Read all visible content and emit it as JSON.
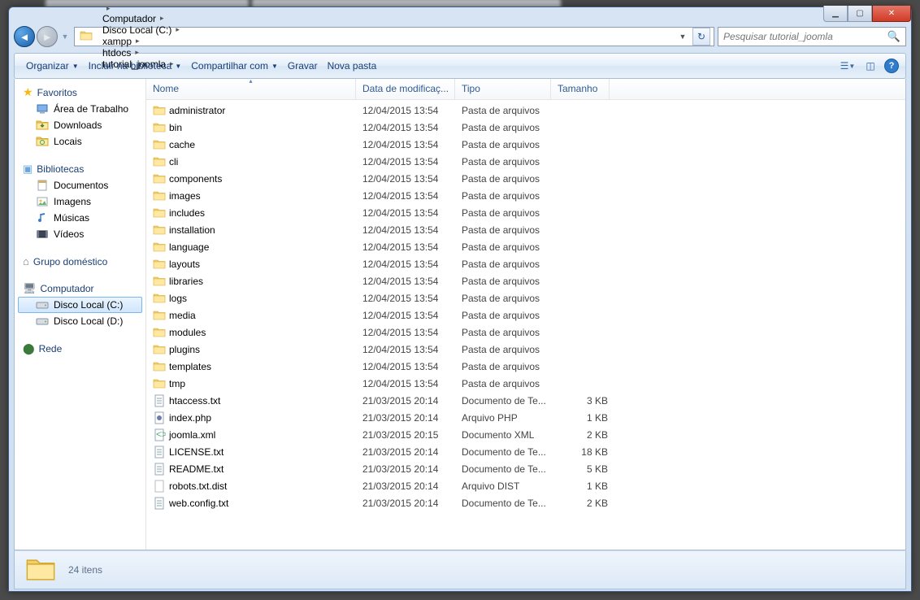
{
  "window_controls": {
    "min": "▁",
    "max": "▢",
    "close": "✕"
  },
  "breadcrumbs": [
    "Computador",
    "Disco Local (C:)",
    "xampp",
    "htdocs",
    "tutorial_joomla"
  ],
  "search": {
    "placeholder": "Pesquisar tutorial_joomla"
  },
  "toolbar": {
    "organize": "Organizar",
    "include": "Incluir na biblioteca",
    "share": "Compartilhar com",
    "burn": "Gravar",
    "newfolder": "Nova pasta"
  },
  "sidebar": {
    "favorites": {
      "label": "Favoritos",
      "items": [
        "Área de Trabalho",
        "Downloads",
        "Locais"
      ]
    },
    "libraries": {
      "label": "Bibliotecas",
      "items": [
        "Documentos",
        "Imagens",
        "Músicas",
        "Vídeos"
      ]
    },
    "homegroup": {
      "label": "Grupo doméstico"
    },
    "computer": {
      "label": "Computador",
      "items": [
        "Disco Local (C:)",
        "Disco Local (D:)"
      ],
      "selected": 0
    },
    "network": {
      "label": "Rede"
    }
  },
  "columns": {
    "name": "Nome",
    "date": "Data de modificaç...",
    "type": "Tipo",
    "size": "Tamanho"
  },
  "rows": [
    {
      "icon": "folder",
      "name": "administrator",
      "date": "12/04/2015 13:54",
      "type": "Pasta de arquivos",
      "size": ""
    },
    {
      "icon": "folder",
      "name": "bin",
      "date": "12/04/2015 13:54",
      "type": "Pasta de arquivos",
      "size": ""
    },
    {
      "icon": "folder",
      "name": "cache",
      "date": "12/04/2015 13:54",
      "type": "Pasta de arquivos",
      "size": ""
    },
    {
      "icon": "folder",
      "name": "cli",
      "date": "12/04/2015 13:54",
      "type": "Pasta de arquivos",
      "size": ""
    },
    {
      "icon": "folder",
      "name": "components",
      "date": "12/04/2015 13:54",
      "type": "Pasta de arquivos",
      "size": ""
    },
    {
      "icon": "folder",
      "name": "images",
      "date": "12/04/2015 13:54",
      "type": "Pasta de arquivos",
      "size": ""
    },
    {
      "icon": "folder",
      "name": "includes",
      "date": "12/04/2015 13:54",
      "type": "Pasta de arquivos",
      "size": ""
    },
    {
      "icon": "folder",
      "name": "installation",
      "date": "12/04/2015 13:54",
      "type": "Pasta de arquivos",
      "size": ""
    },
    {
      "icon": "folder",
      "name": "language",
      "date": "12/04/2015 13:54",
      "type": "Pasta de arquivos",
      "size": ""
    },
    {
      "icon": "folder",
      "name": "layouts",
      "date": "12/04/2015 13:54",
      "type": "Pasta de arquivos",
      "size": ""
    },
    {
      "icon": "folder",
      "name": "libraries",
      "date": "12/04/2015 13:54",
      "type": "Pasta de arquivos",
      "size": ""
    },
    {
      "icon": "folder",
      "name": "logs",
      "date": "12/04/2015 13:54",
      "type": "Pasta de arquivos",
      "size": ""
    },
    {
      "icon": "folder",
      "name": "media",
      "date": "12/04/2015 13:54",
      "type": "Pasta de arquivos",
      "size": ""
    },
    {
      "icon": "folder",
      "name": "modules",
      "date": "12/04/2015 13:54",
      "type": "Pasta de arquivos",
      "size": ""
    },
    {
      "icon": "folder",
      "name": "plugins",
      "date": "12/04/2015 13:54",
      "type": "Pasta de arquivos",
      "size": ""
    },
    {
      "icon": "folder",
      "name": "templates",
      "date": "12/04/2015 13:54",
      "type": "Pasta de arquivos",
      "size": ""
    },
    {
      "icon": "folder",
      "name": "tmp",
      "date": "12/04/2015 13:54",
      "type": "Pasta de arquivos",
      "size": ""
    },
    {
      "icon": "txt",
      "name": "htaccess.txt",
      "date": "21/03/2015 20:14",
      "type": "Documento de Te...",
      "size": "3 KB"
    },
    {
      "icon": "php",
      "name": "index.php",
      "date": "21/03/2015 20:14",
      "type": "Arquivo PHP",
      "size": "1 KB"
    },
    {
      "icon": "xml",
      "name": "joomla.xml",
      "date": "21/03/2015 20:15",
      "type": "Documento XML",
      "size": "2 KB"
    },
    {
      "icon": "txt",
      "name": "LICENSE.txt",
      "date": "21/03/2015 20:14",
      "type": "Documento de Te...",
      "size": "18 KB"
    },
    {
      "icon": "txt",
      "name": "README.txt",
      "date": "21/03/2015 20:14",
      "type": "Documento de Te...",
      "size": "5 KB"
    },
    {
      "icon": "dist",
      "name": "robots.txt.dist",
      "date": "21/03/2015 20:14",
      "type": "Arquivo DIST",
      "size": "1 KB"
    },
    {
      "icon": "txt",
      "name": "web.config.txt",
      "date": "21/03/2015 20:14",
      "type": "Documento de Te...",
      "size": "2 KB"
    }
  ],
  "status": {
    "count": "24 itens"
  }
}
